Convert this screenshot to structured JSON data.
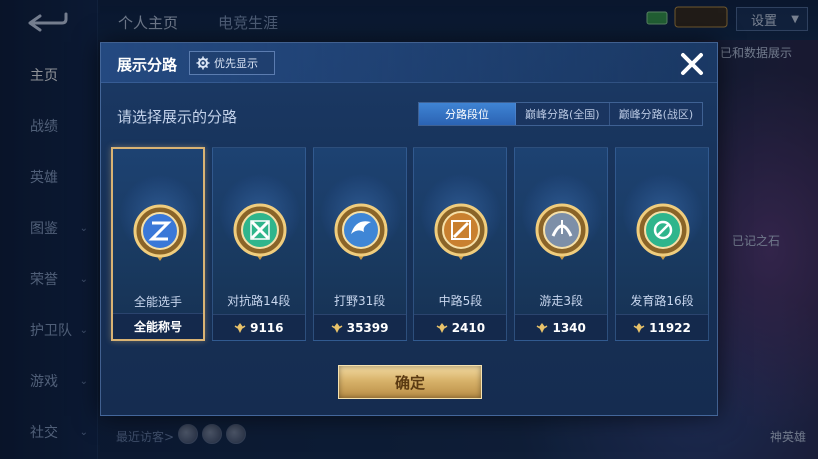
{
  "background": {
    "top_tabs": [
      "个人主页",
      "电竞生涯"
    ],
    "settings_label": "设置",
    "nav_items": [
      {
        "label": "主页",
        "active": true
      },
      {
        "label": "战绩",
        "active": false
      },
      {
        "label": "英雄",
        "active": false
      },
      {
        "label": "图鉴",
        "active": false
      },
      {
        "label": "荣誉",
        "active": false
      },
      {
        "label": "护卫队",
        "active": false
      },
      {
        "label": "游戏",
        "active": false
      },
      {
        "label": "社交",
        "active": false
      }
    ],
    "recent_visitors_label": "最近访客>",
    "right_snippets": [
      "已和数据展示",
      "已记之石",
      "神英雄"
    ]
  },
  "modal": {
    "title": "展示分路",
    "priority_label": "优先显示",
    "subtitle": "请选择展示的分路",
    "segments": [
      {
        "label": "分路段位",
        "active": true
      },
      {
        "label": "巅峰分路(全国)",
        "active": false
      },
      {
        "label": "巅峰分路(战区)",
        "active": false
      }
    ],
    "cards": [
      {
        "role": "全能选手",
        "footer": "全能称号",
        "has_score_icon": false,
        "selected": true,
        "emblem": "all-round-emblem-icon",
        "color": "#3a78d8"
      },
      {
        "role": "对抗路14段",
        "footer": "9116",
        "has_score_icon": true,
        "selected": false,
        "emblem": "clash-lane-emblem-icon",
        "color": "#2fb58c"
      },
      {
        "role": "打野31段",
        "footer": "35399",
        "has_score_icon": true,
        "selected": false,
        "emblem": "jungle-emblem-icon",
        "color": "#3f86d6"
      },
      {
        "role": "中路5段",
        "footer": "2410",
        "has_score_icon": true,
        "selected": false,
        "emblem": "mid-lane-emblem-icon",
        "color": "#c9802f"
      },
      {
        "role": "游走3段",
        "footer": "1340",
        "has_score_icon": true,
        "selected": false,
        "emblem": "roam-emblem-icon",
        "color": "#7d8fa8"
      },
      {
        "role": "发育路16段",
        "footer": "11922",
        "has_score_icon": true,
        "selected": false,
        "emblem": "farm-lane-emblem-icon",
        "color": "#2fb58c"
      }
    ],
    "confirm_label": "确定"
  }
}
